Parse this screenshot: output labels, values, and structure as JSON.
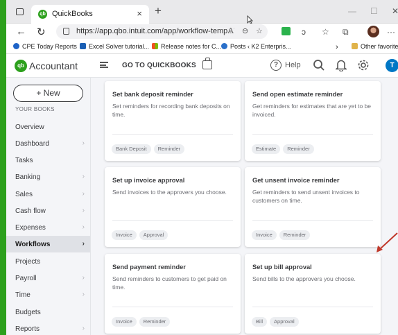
{
  "browser": {
    "tab_title": "QuickBooks",
    "url": "https://app.qbo.intuit.com/app/workflow-temp...",
    "favorites": [
      {
        "label": "CPE Today Reports",
        "color": "#1e63c7"
      },
      {
        "label": "Excel Solver tutorial...",
        "color": "#1a5fb4"
      },
      {
        "label": "Release notes for C...",
        "color": "#c93b2a"
      },
      {
        "label": "Posts ‹ K2 Enterpris...",
        "color": "#2a6fc9"
      },
      {
        "label": "Other favorites",
        "color": "#e0b34a"
      }
    ]
  },
  "app": {
    "logo_badge": "qb",
    "logo_text": "Accountant",
    "goto_label": "GO TO QUICKBOOKS",
    "help_label": "Help",
    "user_initial": "T",
    "accent": "#2ca01c"
  },
  "sidebar": {
    "new_label": "+ New",
    "section_label": "YOUR BOOKS",
    "items": [
      {
        "label": "Overview",
        "chev": ""
      },
      {
        "label": "Dashboard",
        "chev": "›"
      },
      {
        "label": "Tasks",
        "chev": ""
      },
      {
        "label": "Banking",
        "chev": "›"
      },
      {
        "label": "Sales",
        "chev": "›"
      },
      {
        "label": "Cash flow",
        "chev": "›"
      },
      {
        "label": "Expenses",
        "chev": "›"
      },
      {
        "label": "Workflows",
        "chev": "›",
        "active": true
      },
      {
        "label": "Projects",
        "chev": ""
      },
      {
        "label": "Payroll",
        "chev": "›"
      },
      {
        "label": "Time",
        "chev": "›"
      },
      {
        "label": "Budgets",
        "chev": ""
      },
      {
        "label": "Reports",
        "chev": "›"
      }
    ]
  },
  "cards": [
    {
      "title": "Set bank deposit reminder",
      "desc": "Set reminders for recording bank deposits on time.",
      "tags": [
        "Bank Deposit",
        "Reminder"
      ]
    },
    {
      "title": "Send open estimate reminder",
      "desc": "Get reminders for estimates that are yet to be invoiced.",
      "tags": [
        "Estimate",
        "Reminder"
      ]
    },
    {
      "title": "Set up invoice approval",
      "desc": "Send invoices to the approvers you choose.",
      "tags": [
        "Invoice",
        "Approval"
      ]
    },
    {
      "title": "Get unsent invoice reminder",
      "desc": "Get reminders to send unsent invoices to customers on time.",
      "tags": [
        "Invoice",
        "Reminder"
      ]
    },
    {
      "title": "Send payment reminder",
      "desc": "Send reminders to customers to get paid on time.",
      "tags": [
        "Invoice",
        "Reminder"
      ]
    },
    {
      "title": "Set up bill approval",
      "desc": "Send bills to the approvers you choose.",
      "tags": [
        "Bill",
        "Approval"
      ]
    }
  ]
}
